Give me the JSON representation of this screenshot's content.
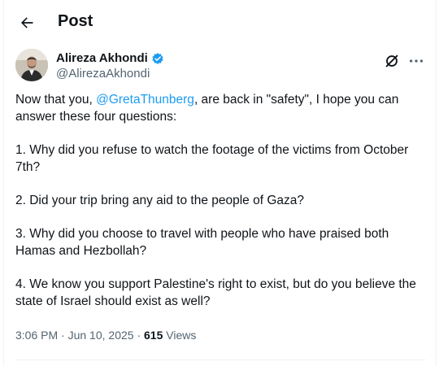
{
  "header": {
    "title": "Post"
  },
  "author": {
    "name": "Alireza Akhondi",
    "handle": "@AlirezaAkhondi",
    "verified": true
  },
  "post": {
    "intro_before": "Now that you, ",
    "mention": "@GretaThunberg",
    "intro_after": ", are back in \"safety\", I hope you can answer these four questions:",
    "q1": "1. Why did you refuse to watch the footage of the victims from October 7th?",
    "q2": "2. Did your trip bring any aid to the people of Gaza?",
    "q3": "3. Why did you choose to travel with people who have praised both Hamas and Hezbollah?",
    "q4": "4. We know you support Palestine's right to exist, but do you believe the state of Israel should exist as well?"
  },
  "meta": {
    "time": "3:06 PM",
    "separator": " · ",
    "date": "Jun 10, 2025",
    "views_count": "615",
    "views_label": "Views"
  },
  "colors": {
    "accent": "#1d9bf0",
    "text": "#0f1419",
    "secondary": "#536471"
  },
  "icons": {
    "back": "arrow-left-icon",
    "verified": "verified-badge-icon",
    "grok": "grok-icon",
    "more": "more-icon"
  }
}
